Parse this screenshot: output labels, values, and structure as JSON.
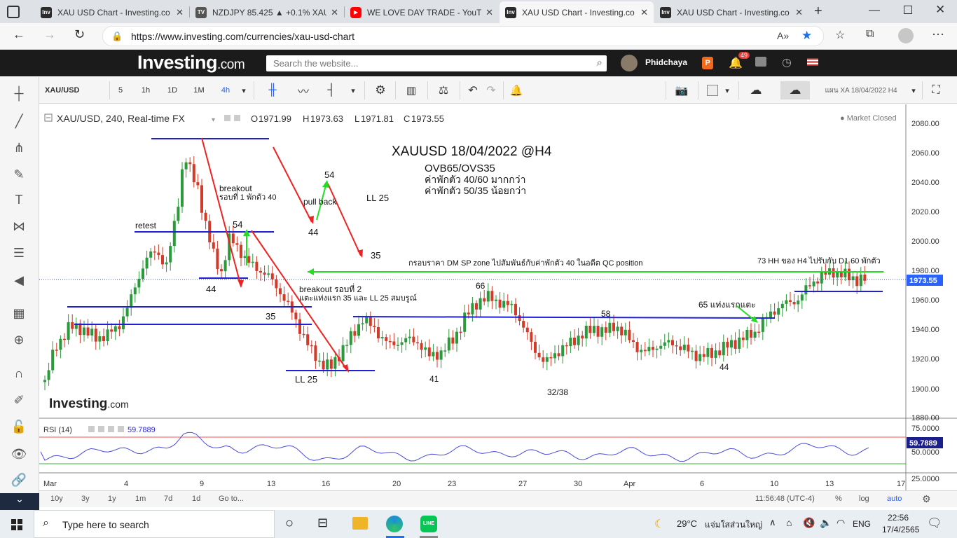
{
  "browser": {
    "tabs": [
      {
        "title": "XAU USD Chart - Investing.co",
        "favicon": "investing"
      },
      {
        "title": "NZDJPY 85.425 ▲ +0.1% XAU",
        "favicon": "tradingview"
      },
      {
        "title": "WE LOVE DAY TRADE - YouTu",
        "favicon": "youtube"
      },
      {
        "title": "XAU USD Chart - Investing.co",
        "favicon": "investing",
        "active": true
      },
      {
        "title": "XAU USD Chart - Investing.co",
        "favicon": "investing"
      }
    ],
    "url": "https://www.investing.com/currencies/xau-usd-chart"
  },
  "site": {
    "logo": "Investing",
    "logo_suffix": ".com",
    "search_placeholder": "Search the website...",
    "username": "Phidchaya",
    "notification_count": "49"
  },
  "toolbar": {
    "symbol": "XAU/USD",
    "intervals": [
      "5",
      "1h",
      "1D",
      "1M",
      "4h"
    ],
    "active_interval": "4h",
    "layout_name": "แผน XA 18/04/2022 H4"
  },
  "chart": {
    "legend_title": "XAU/USD, 240, Real-time FX",
    "ohlc": {
      "o_label": "O",
      "o": "1971.99",
      "h_label": "H",
      "h": "1973.63",
      "l_label": "L",
      "l": "1971.81",
      "c_label": "C",
      "c": "1973.55"
    },
    "status": "Market Closed",
    "price_labels": [
      "2080.00",
      "2060.00",
      "2040.00",
      "2020.00",
      "2000.00",
      "1980.00",
      "1960.00",
      "1940.00",
      "1920.00",
      "1900.00",
      "1880.00"
    ],
    "last_price": "1973.55",
    "x_labels": [
      "Mar",
      "4",
      "9",
      "13",
      "16",
      "20",
      "23",
      "27",
      "30",
      "Apr",
      "6",
      "10",
      "13",
      "17"
    ],
    "watermark": "Investing",
    "watermark_suffix": ".com",
    "annotations": {
      "title": "XAUUSD 18/04/2022 @H4",
      "line1": "OVB65/OVS35",
      "line2": "ค่าพักตัว 40/60 มากกว่า",
      "line3": "ค่าพักตัว 50/35 น้อยกว่า",
      "breakout1": "breakout",
      "breakout1b": "รอบที่ 1 พักตัว 40",
      "retest": "retest",
      "n54a": "54",
      "n44a": "44",
      "n35a": "35",
      "breakout2": "breakout รอบที่ 2",
      "breakout2b": "แตะแท่งแรก 35 และ LL 25 สมบรูณ์",
      "ll25a": "LL 25",
      "n54b": "54",
      "pullback": "pull back",
      "n44b": "44",
      "ll25b": "LL 25",
      "n35b": "35",
      "zone": "กรอบราคา DM SP zone ไปสัมพันธ์กับค่าพักตัว 40 ในอดีต QC position",
      "hh73": "73 HH ของ H4 ไปรับกับ D1 60 พักตัว",
      "n66": "66",
      "n58": "58",
      "n41": "41",
      "n3238": "32/38",
      "n65": "65 แท่งแรกแตะ",
      "n44c": "44"
    },
    "rsi": {
      "label": "RSI (14)",
      "value": "59.7889",
      "levels": [
        "75.0000",
        "50.0000",
        "25.0000"
      ]
    }
  },
  "bottom_bar": {
    "ranges": [
      "10y",
      "3y",
      "1y",
      "1m",
      "7d",
      "1d"
    ],
    "goto": "Go to...",
    "time": "11:56:48 (UTC-4)",
    "percent": "%",
    "log": "log",
    "auto": "auto"
  },
  "taskbar": {
    "search_placeholder": "Type here to search",
    "weather_temp": "29°C",
    "weather_text": "แจ่มใสส่วนใหญ่",
    "lang": "ENG",
    "time": "22:56",
    "date": "17/4/2565"
  },
  "colors": {
    "bull": "#2a9a3a",
    "bear": "#d23a2a",
    "blue_line": "#1f1fd6",
    "red_arrow": "#ee2222",
    "green_arrow": "#22dd22",
    "rsi_line": "#4a4ad8",
    "header_bg": "#1b1b1b",
    "accent_blue": "#2962ff"
  }
}
